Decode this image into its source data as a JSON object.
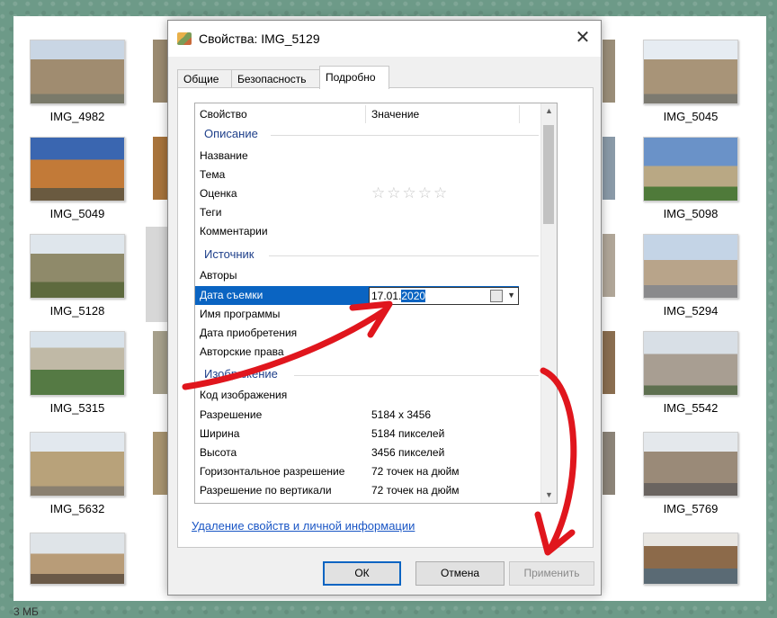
{
  "explorer": {
    "status_size": "3 МБ",
    "thumbnails": [
      {
        "caption": "IMG_4982",
        "color": "#9a8a70"
      },
      {
        "caption": "IMG_5049",
        "color": "#b9733a"
      },
      {
        "caption": "IMG_5128",
        "color": "#8c8a6e"
      },
      {
        "caption": "IMG_5315",
        "color": "#8f9c88"
      },
      {
        "caption": "IMG_5632",
        "color": "#a89470"
      },
      {
        "caption": "",
        "color": "#9a8a78"
      },
      {
        "caption": "IMG_5045",
        "color": "#9a8d78"
      },
      {
        "caption": "IMG_5098",
        "color": "#6f8fb0"
      },
      {
        "caption": "IMG_5294",
        "color": "#8fa2b8"
      },
      {
        "caption": "IMG_5542",
        "color": "#a4a09a"
      },
      {
        "caption": "IMG_5769",
        "color": "#8c8074"
      },
      {
        "caption": "",
        "color": "#7c6a54"
      }
    ]
  },
  "dialog": {
    "title": "Свойства: IMG_5129",
    "close": "✕",
    "tabs": [
      "Общие",
      "Безопасность",
      "Подробно"
    ],
    "columns": {
      "property": "Свойство",
      "value": "Значение"
    },
    "sections": {
      "description": "Описание",
      "source": "Источник",
      "image": "Изображение"
    },
    "rows": {
      "name": "Название",
      "subject": "Тема",
      "rating": "Оценка",
      "tags": "Теги",
      "comments": "Комментарии",
      "authors": "Авторы",
      "date_taken": "Дата съемки",
      "program": "Имя программы",
      "date_acquired": "Дата приобретения",
      "copyright": "Авторские права",
      "image_id": "Код изображения",
      "resolution": "Разрешение",
      "width": "Ширина",
      "height": "Высота",
      "h_res": "Горизонтальное разрешение",
      "v_res": "Разрешение по вертикали"
    },
    "values": {
      "rating_stars": "☆☆☆☆☆",
      "date_prefix": "17.01.",
      "date_selected": "2020",
      "resolution": "5184 x 3456",
      "width": "5184 пикселей",
      "height": "3456 пикселей",
      "h_res": "72 точек на дюйм",
      "v_res": "72 точек на дюйм"
    },
    "remove_link": "Удаление свойств и личной информации",
    "buttons": {
      "ok": "ОК",
      "cancel": "Отмена",
      "apply": "Применить"
    },
    "accent_color": "#0a64c2",
    "annotation_arrow_color": "#e0161d"
  }
}
